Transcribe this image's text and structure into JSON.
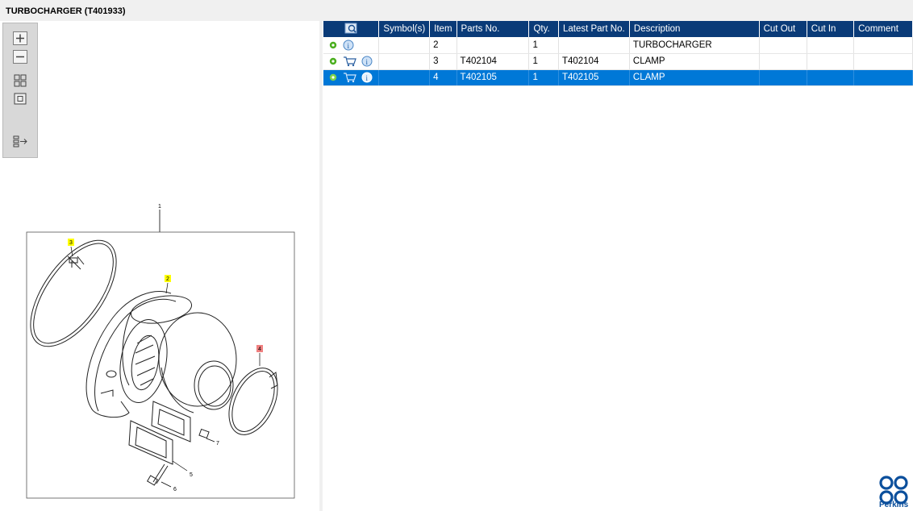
{
  "window": {
    "title": "TURBOCHARGER (T401933)"
  },
  "toolbar": {
    "buttons": [
      {
        "name": "zoom-in",
        "icon": "plus-icon"
      },
      {
        "name": "zoom-out",
        "icon": "minus-icon"
      },
      {
        "name": "fit-all",
        "icon": "grid-icon"
      },
      {
        "name": "actual-size",
        "icon": "square-icon"
      },
      {
        "name": "show-list",
        "icon": "list-export-icon"
      }
    ]
  },
  "diagram": {
    "callouts": {
      "c1": "1",
      "c2": "2",
      "c3": "3",
      "c4": "4",
      "c5": "5",
      "c6": "6",
      "c7": "7"
    }
  },
  "parts_table": {
    "columns": [
      "",
      "Symbol(s)",
      "Item",
      "Parts No.",
      "Qty.",
      "Latest Part No.",
      "Description",
      "Cut Out",
      "Cut In",
      "Comment"
    ],
    "rows": [
      {
        "item": "2",
        "part_no": "",
        "qty": "1",
        "latest": "",
        "description": "TURBOCHARGER",
        "cut_out": "",
        "cut_in": "",
        "comment": "",
        "cart": false,
        "selected": false
      },
      {
        "item": "3",
        "part_no": "T402104",
        "qty": "1",
        "latest": "T402104",
        "description": "CLAMP",
        "cut_out": "",
        "cut_in": "",
        "comment": "",
        "cart": true,
        "selected": false
      },
      {
        "item": "4",
        "part_no": "T402105",
        "qty": "1",
        "latest": "T402105",
        "description": "CLAMP",
        "cut_out": "",
        "cut_in": "",
        "comment": "",
        "cart": true,
        "selected": true
      }
    ]
  },
  "brand": {
    "name": "Perkins",
    "color": "#0b4f9c"
  },
  "colors": {
    "header_bg": "#0a3b78",
    "selection": "#0078d7",
    "highlight_yellow": "#ffff00",
    "highlight_red": "#f08080"
  }
}
